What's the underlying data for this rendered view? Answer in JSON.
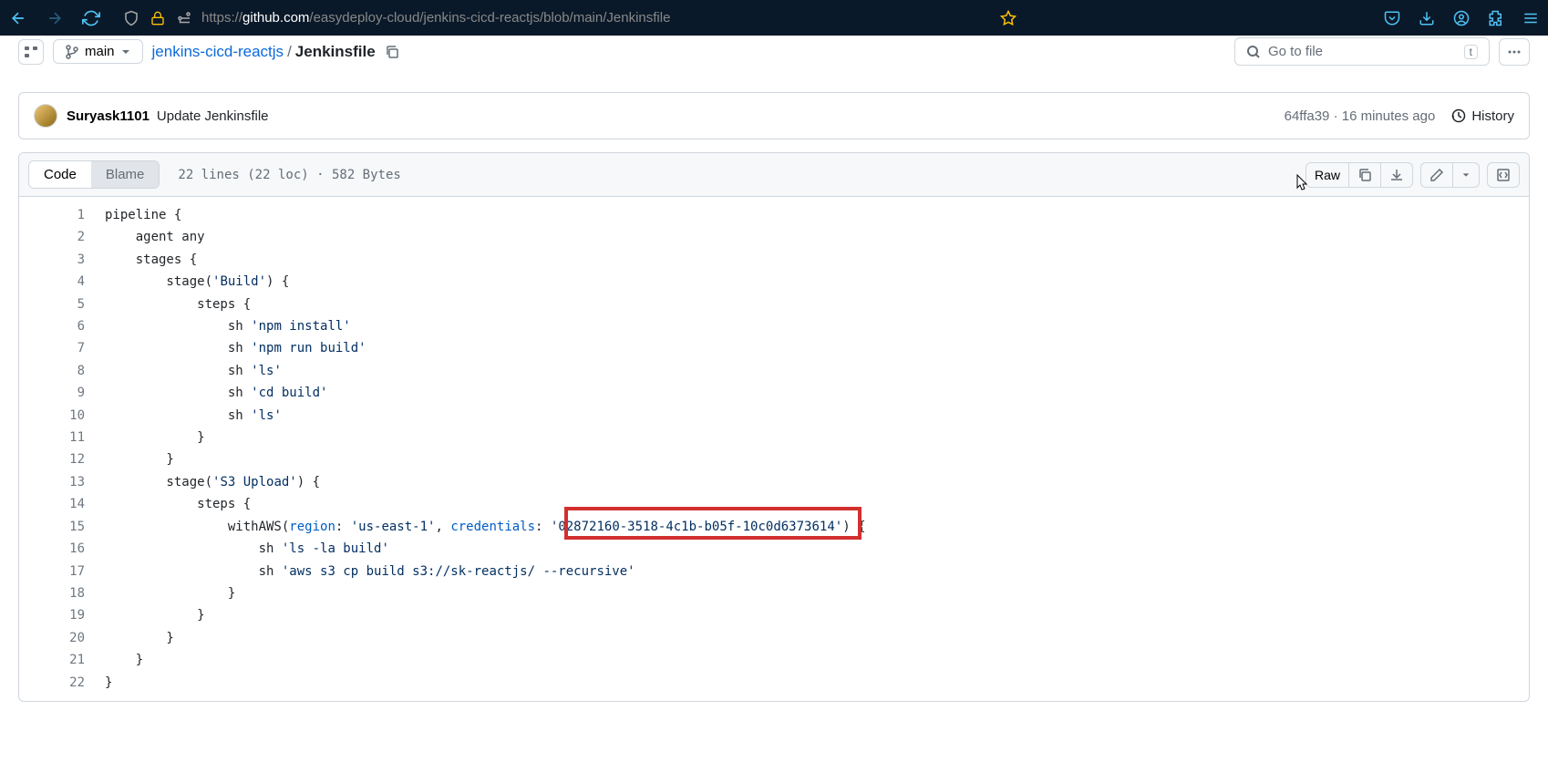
{
  "browser": {
    "url_prefix": "https://",
    "url_domain": "github.com",
    "url_path": "/easydeploy-cloud/jenkins-cicd-reactjs/blob/main/Jenkinsfile"
  },
  "path": {
    "branch": "main",
    "repo": "jenkins-cicd-reactjs",
    "file": "Jenkinsfile",
    "search_placeholder": "Go to file",
    "search_kbd": "t"
  },
  "commit": {
    "author": "Suryask1101",
    "message": "Update Jenkinsfile",
    "sha": "64ffa39",
    "time": "16 minutes ago",
    "history": "History"
  },
  "file_header": {
    "tab_code": "Code",
    "tab_blame": "Blame",
    "info": "22 lines (22 loc) · 582 Bytes",
    "raw": "Raw"
  },
  "code": {
    "lines": [
      {
        "n": "1",
        "pre": "pipeline {"
      },
      {
        "n": "2",
        "pre": "    agent any"
      },
      {
        "n": "3",
        "pre": "    stages {"
      },
      {
        "n": "4",
        "pre": "        stage(",
        "str": "'Build'",
        "post": ") {"
      },
      {
        "n": "5",
        "pre": "            steps {"
      },
      {
        "n": "6",
        "pre": "                sh ",
        "str": "'npm install'"
      },
      {
        "n": "7",
        "pre": "                sh ",
        "str": "'npm run build'"
      },
      {
        "n": "8",
        "pre": "                sh ",
        "str": "'ls'"
      },
      {
        "n": "9",
        "pre": "                sh ",
        "str": "'cd build'"
      },
      {
        "n": "10",
        "pre": "                sh ",
        "str": "'ls'"
      },
      {
        "n": "11",
        "pre": "            }"
      },
      {
        "n": "12",
        "pre": "        }"
      },
      {
        "n": "13",
        "pre": "        stage(",
        "str": "'S3 Upload'",
        "post": ") {"
      },
      {
        "n": "14",
        "pre": "            steps {"
      },
      {
        "n": "15",
        "pre": "                withAWS(",
        "p1": "region",
        "pre2": ": ",
        "str": "'us-east-1'",
        "pre3": ", ",
        "p2": "credentials",
        "pre4": ": ",
        "str2": "'02872160-3518-4c1b-b05f-10c0d6373614'",
        "post": ") {"
      },
      {
        "n": "16",
        "pre": "                    sh ",
        "str": "'ls -la build'"
      },
      {
        "n": "17",
        "pre": "                    sh ",
        "str": "'aws s3 cp build s3://sk-reactjs/ --recursive'"
      },
      {
        "n": "18",
        "pre": "                }"
      },
      {
        "n": "19",
        "pre": "            }"
      },
      {
        "n": "20",
        "pre": "        }"
      },
      {
        "n": "21",
        "pre": "    }"
      },
      {
        "n": "22",
        "pre": "}"
      }
    ]
  }
}
